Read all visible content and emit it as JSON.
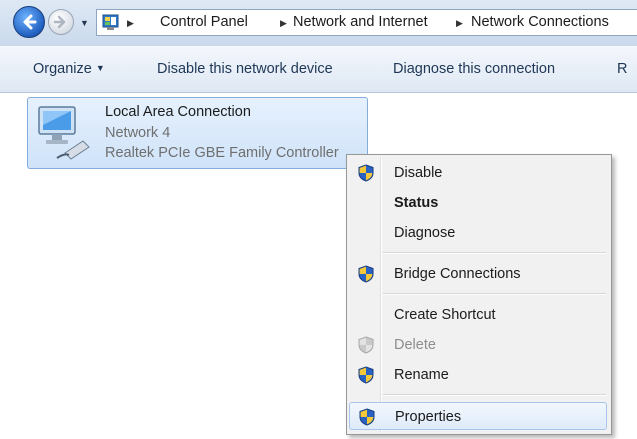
{
  "breadcrumb": {
    "items": [
      "Control Panel",
      "Network and Internet",
      "Network Connections"
    ]
  },
  "toolbar": {
    "organize": "Organize",
    "disable_device": "Disable this network device",
    "diagnose": "Diagnose this connection",
    "overflow": "R"
  },
  "connection": {
    "name": "Local Area Connection",
    "network": "Network 4",
    "adapter": "Realtek PCIe GBE Family Controller"
  },
  "context_menu": {
    "items": [
      {
        "label": "Disable",
        "icon": "uac-shield-icon"
      },
      {
        "label": "Status",
        "icon": null,
        "bold": true
      },
      {
        "label": "Diagnose",
        "icon": null
      },
      {
        "label": "Bridge Connections",
        "icon": "uac-shield-icon"
      },
      {
        "label": "Create Shortcut",
        "icon": null
      },
      {
        "label": "Delete",
        "icon": "uac-shield-icon",
        "disabled": true
      },
      {
        "label": "Rename",
        "icon": "uac-shield-icon"
      },
      {
        "label": "Properties",
        "icon": "uac-shield-icon",
        "highlighted": true
      }
    ]
  },
  "colors": {
    "selection_fill": "#cfe3f9",
    "selection_border": "#84acdd",
    "menu_background": "#f1f1f1"
  }
}
